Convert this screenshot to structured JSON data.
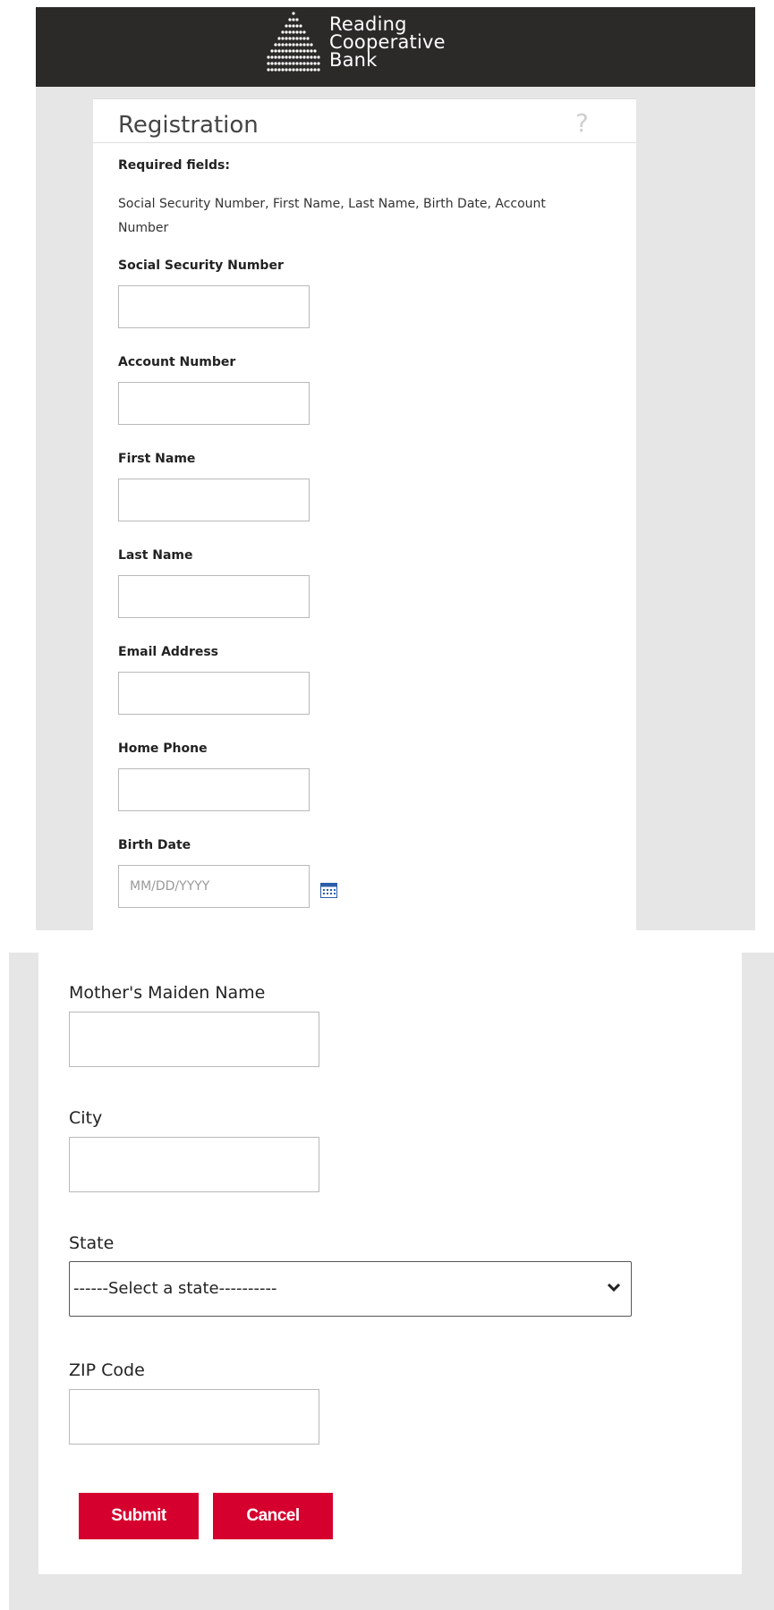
{
  "header": {
    "brand_line1": "Reading",
    "brand_line2": "Cooperative",
    "brand_line3": "Bank",
    "icon": "bank-logo-dots"
  },
  "registration": {
    "title": "Registration",
    "help_icon": "?",
    "required_heading": "Required fields:",
    "required_list": "Social Security Number, First Name, Last Name, Birth Date, Account Number",
    "fields": {
      "ssn": {
        "label": "Social Security Number",
        "value": "",
        "placeholder": ""
      },
      "account_number": {
        "label": "Account Number",
        "value": "",
        "placeholder": ""
      },
      "first_name": {
        "label": "First Name",
        "value": "",
        "placeholder": ""
      },
      "last_name": {
        "label": "Last Name",
        "value": "",
        "placeholder": ""
      },
      "email": {
        "label": "Email Address",
        "value": "",
        "placeholder": ""
      },
      "home_phone": {
        "label": "Home Phone",
        "value": "",
        "placeholder": ""
      },
      "birth_date": {
        "label": "Birth Date",
        "value": "",
        "placeholder": "MM/DD/YYYY",
        "icon": "calendar-icon"
      },
      "maiden_name": {
        "label": "Mother's Maiden Name",
        "value": ""
      },
      "city": {
        "label": "City",
        "value": ""
      },
      "state": {
        "label": "State",
        "selected": "------Select a state----------"
      },
      "zip": {
        "label": "ZIP Code",
        "value": ""
      }
    },
    "buttons": {
      "submit": "Submit",
      "cancel": "Cancel"
    }
  },
  "colors": {
    "header_bg": "#2b2a29",
    "page_bg": "#e6e6e6",
    "accent_button": "#d6002e",
    "calendar_icon": "#2a5ea8"
  }
}
